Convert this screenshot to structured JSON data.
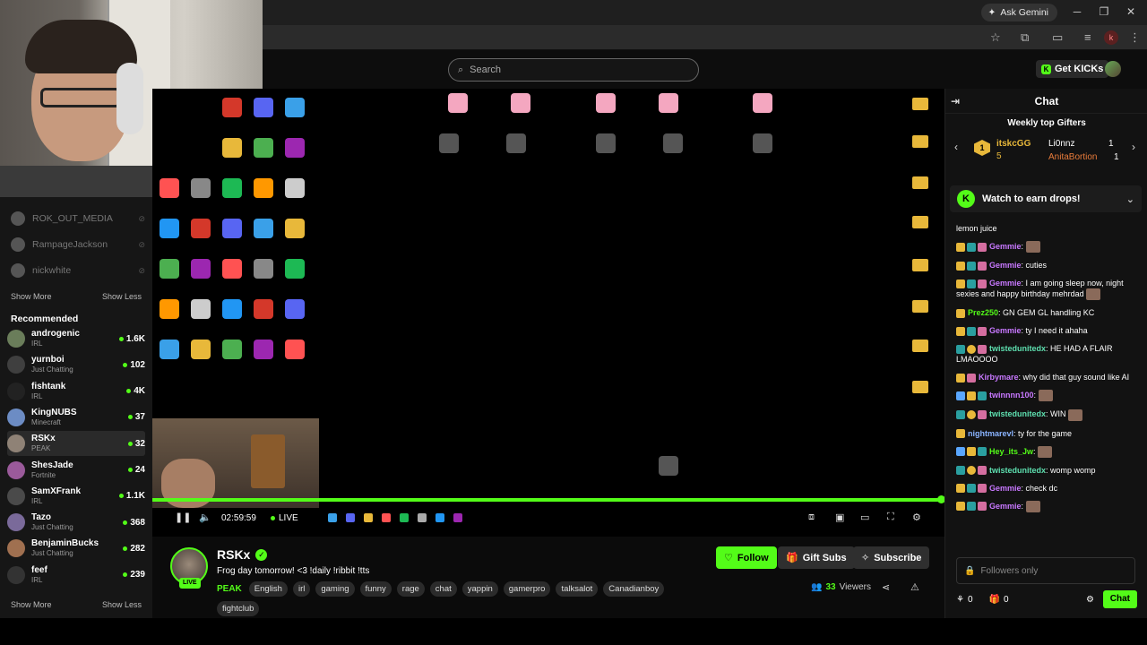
{
  "browser": {
    "ask_gemini": "Ask Gemini",
    "profile_letter": "k"
  },
  "header": {
    "search_placeholder": "Search",
    "get_kicks": "Get KICKs"
  },
  "sidebar": {
    "following": [
      {
        "name": "ROK_OUT_MEDIA"
      },
      {
        "name": "RampageJackson"
      },
      {
        "name": "nickwhite"
      }
    ],
    "show_more": "Show More",
    "show_less": "Show Less",
    "recommended_title": "Recommended",
    "recommended": [
      {
        "name": "androgenic",
        "category": "IRL",
        "viewers": "1.6K",
        "color": "#6a7d5a"
      },
      {
        "name": "yurnboi",
        "category": "Just Chatting",
        "viewers": "102",
        "color": "#3f3f3f"
      },
      {
        "name": "fishtank",
        "category": "IRL",
        "viewers": "4K",
        "color": "#222222"
      },
      {
        "name": "KingNUBS",
        "category": "Minecraft",
        "viewers": "37",
        "color": "#6c8cc4"
      },
      {
        "name": "RSKx",
        "category": "PEAK",
        "viewers": "32",
        "color": "#8f8276"
      },
      {
        "name": "ShesJade",
        "category": "Fortnite",
        "viewers": "24",
        "color": "#9a5a9a"
      },
      {
        "name": "SamXFrank",
        "category": "IRL",
        "viewers": "1.1K",
        "color": "#4a4a4a"
      },
      {
        "name": "Tazo",
        "category": "Just Chatting",
        "viewers": "368",
        "color": "#7a6a9a"
      },
      {
        "name": "BenjaminBucks",
        "category": "Just Chatting",
        "viewers": "282",
        "color": "#a07050"
      },
      {
        "name": "feef",
        "category": "IRL",
        "viewers": "239",
        "color": "#333333"
      }
    ],
    "show_more_2": "Show More",
    "show_less_2": "Show Less"
  },
  "player": {
    "time": "02:59:59",
    "live": "LIVE",
    "progress": 1.0
  },
  "stream": {
    "streamer": "RSKx",
    "live_badge": "LIVE",
    "title": "Frog day tomorrow! <3 !daily !ribbit !tts",
    "category": "PEAK",
    "tags": [
      "English",
      "irl",
      "gaming",
      "funny",
      "rage",
      "chat",
      "yappin",
      "gamerpro",
      "talksalot",
      "Canadianboy",
      "fightclub"
    ],
    "follow_label": "Follow",
    "gift_label": "Gift Subs",
    "subscribe_label": "Subscribe",
    "viewers_count": "33",
    "viewers_label": "Viewers"
  },
  "chat": {
    "title": "Chat",
    "gifters_title": "Weekly top Gifters",
    "top_gifter": {
      "name": "itskcGG",
      "count": "5"
    },
    "gifters": [
      {
        "name": "Li0nnz",
        "count": "1"
      },
      {
        "name": "AnitaBortion",
        "count": "1"
      }
    ],
    "drops": "Watch to earn drops!",
    "partial_line": "lemon juice",
    "messages": [
      {
        "user": "Gemmie",
        "color": "#c878ff",
        "text": "",
        "badges": [
          "crown",
          "sub",
          "gift"
        ],
        "emote": true
      },
      {
        "user": "Gemmie",
        "color": "#c878ff",
        "text": "cuties",
        "badges": [
          "crown",
          "sub",
          "gift"
        ]
      },
      {
        "user": "Gemmie",
        "color": "#c878ff",
        "text": "I am going sleep now, night sexies and happy birthday mehrdad",
        "badges": [
          "crown",
          "sub",
          "gift"
        ],
        "emote": true
      },
      {
        "user": "Prez250",
        "color": "#53fc18",
        "text": "GN GEM GL handling KC",
        "badges": [
          "crown"
        ]
      },
      {
        "user": "Gemmie",
        "color": "#c878ff",
        "text": "ty I need it ahaha",
        "badges": [
          "crown",
          "sub",
          "gift"
        ]
      },
      {
        "user": "twistedunitedx",
        "color": "#5ee0b0",
        "text": "HE HAD A FLAIR LMAOOOO",
        "badges": [
          "sub",
          "one",
          "gift"
        ]
      },
      {
        "user": "Kirbymare",
        "color": "#c878ff",
        "text": "why did that guy sound like AI",
        "badges": [
          "crown",
          "gift"
        ]
      },
      {
        "user": "twinnnn100",
        "color": "#c878ff",
        "text": "",
        "badges": [
          "vip",
          "crown",
          "sub"
        ],
        "emote": true
      },
      {
        "user": "twistedunitedx",
        "color": "#5ee0b0",
        "text": "WIN",
        "badges": [
          "sub",
          "one",
          "gift"
        ],
        "emote": true
      },
      {
        "user": "nightmarevl",
        "color": "#8ab4ff",
        "text": "ty for the game",
        "badges": [
          "crown"
        ]
      },
      {
        "user": "Hey_its_Jw",
        "color": "#53fc18",
        "text": "",
        "badges": [
          "vip",
          "crown",
          "sub"
        ],
        "emote": true
      },
      {
        "user": "twistedunitedx",
        "color": "#5ee0b0",
        "text": "womp womp",
        "badges": [
          "sub",
          "one",
          "gift"
        ]
      },
      {
        "user": "Gemmie",
        "color": "#c878ff",
        "text": "check dc",
        "badges": [
          "crown",
          "sub",
          "gift"
        ]
      },
      {
        "user": "Gemmie",
        "color": "#c878ff",
        "text": "",
        "badges": [
          "crown",
          "sub",
          "gift"
        ],
        "emote": true
      }
    ],
    "input_placeholder": "Followers only",
    "kicks_count": "0",
    "gifts_count": "0",
    "send_label": "Chat"
  },
  "colors": {
    "accent": "#53fc18",
    "background": "#0d0d0d"
  }
}
